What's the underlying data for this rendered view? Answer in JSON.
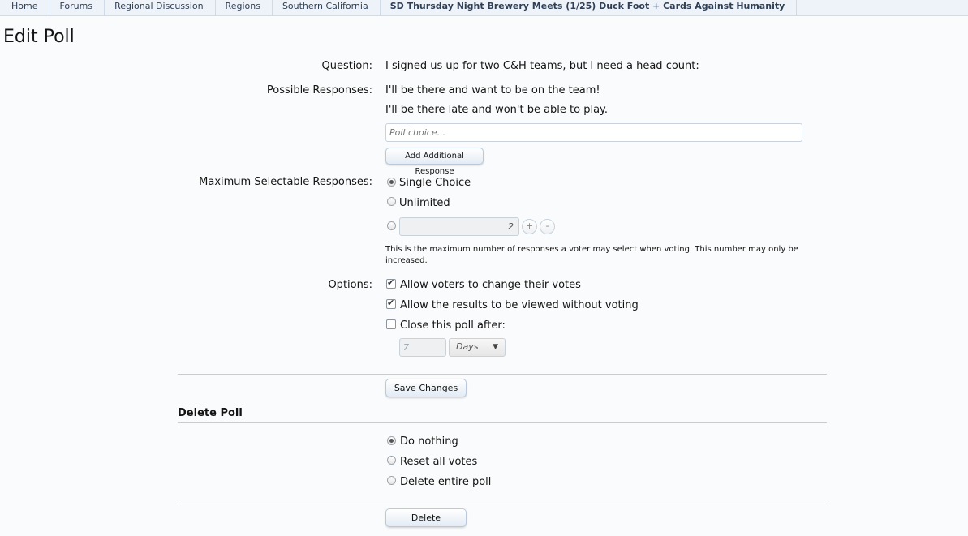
{
  "breadcrumb": [
    "Home",
    "Forums",
    "Regional Discussion",
    "Regions",
    "Southern California",
    "SD Thursday Night Brewery Meets (1/25) Duck Foot + Cards Against Humanity"
  ],
  "page_title": "Edit Poll",
  "question": {
    "label": "Question:",
    "value": "I signed us up for two C&H teams, but I need a head count:"
  },
  "responses": {
    "label": "Possible Responses:",
    "items": [
      "I'll be there and want to be on the team!",
      "I'll be there late and won't be able to play."
    ],
    "placeholder": "Poll choice...",
    "add_button": "Add Additional Response"
  },
  "max_responses": {
    "label": "Maximum Selectable Responses:",
    "single": "Single Choice",
    "unlimited": "Unlimited",
    "number_value": "2",
    "plus": "+",
    "minus": "-",
    "selected": "single",
    "hint": "This is the maximum number of responses a voter may select when voting. This number may only be increased."
  },
  "options": {
    "label": "Options:",
    "change_votes": "Allow voters to change their votes",
    "view_results": "Allow the results to be viewed without voting",
    "close_after": "Close this poll after:",
    "close_value": "7",
    "close_unit": "Days",
    "change_votes_checked": true,
    "view_results_checked": true,
    "close_after_checked": false
  },
  "save_button": "Save Changes",
  "delete_section": {
    "title": "Delete Poll",
    "do_nothing": "Do nothing",
    "reset_votes": "Reset all votes",
    "delete_entire": "Delete entire poll",
    "selected": "do_nothing",
    "delete_button": "Delete"
  }
}
